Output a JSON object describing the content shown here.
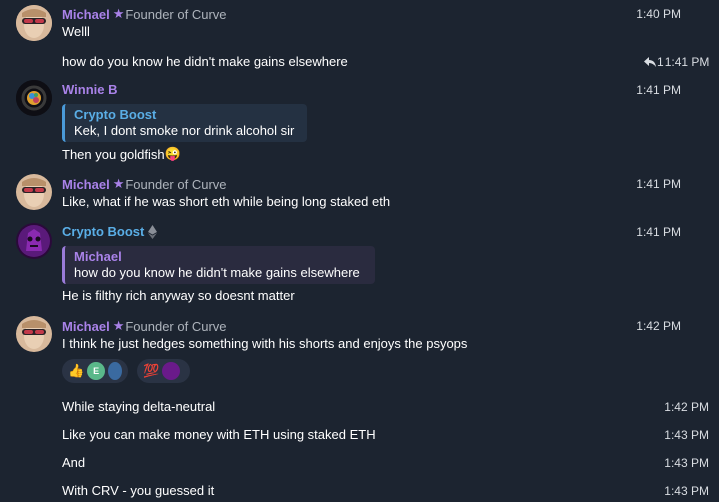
{
  "colors": {
    "michael": "#a982e8",
    "winnie": "#a982e8",
    "crypto_boost": "#5aaee6",
    "background": "#1c2430"
  },
  "user_titles": {
    "michael": "Founder of Curve"
  },
  "messages": [
    {
      "author": "Michael",
      "title": "Founder of Curve",
      "text": "Welll",
      "time": "1:40 PM"
    },
    {
      "text": "how do you know he didn't make gains elsewhere",
      "reply_count": "1",
      "time": "1:41 PM"
    },
    {
      "author": "Winnie B",
      "reply_to": {
        "author": "Crypto Boost",
        "text": "Kek, I dont smoke nor drink alcohol sir"
      },
      "text": "Then you goldfish",
      "emoji": "😜",
      "time": "1:41 PM"
    },
    {
      "author": "Michael",
      "title": "Founder of Curve",
      "text": "Like, what if he was short eth while being long staked eth",
      "time": "1:41 PM"
    },
    {
      "author": "Crypto Boost",
      "reply_to": {
        "author": "Michael",
        "text": "how do you know he didn't make gains elsewhere"
      },
      "text": "He is filthy rich anyway so doesnt matter",
      "time": "1:41 PM"
    },
    {
      "author": "Michael",
      "title": "Founder of Curve",
      "text": "I think he just hedges something with his shorts and enjoys the psyops",
      "time": "1:42 PM"
    },
    {
      "text": "While staying delta-neutral",
      "time": "1:42 PM"
    },
    {
      "text": "Like you can make money with ETH using staked ETH",
      "time": "1:43 PM"
    },
    {
      "text": "And",
      "time": "1:43 PM"
    },
    {
      "text": "With CRV - you guessed it",
      "time": "1:43 PM"
    }
  ],
  "reactions": [
    {
      "emoji": "👍",
      "avatars": [
        "E"
      ]
    },
    {
      "emoji": "💯",
      "avatars": []
    }
  ],
  "icons": [
    "star-icon",
    "reply-arrow-icon",
    "ethereum-badge-icon"
  ]
}
